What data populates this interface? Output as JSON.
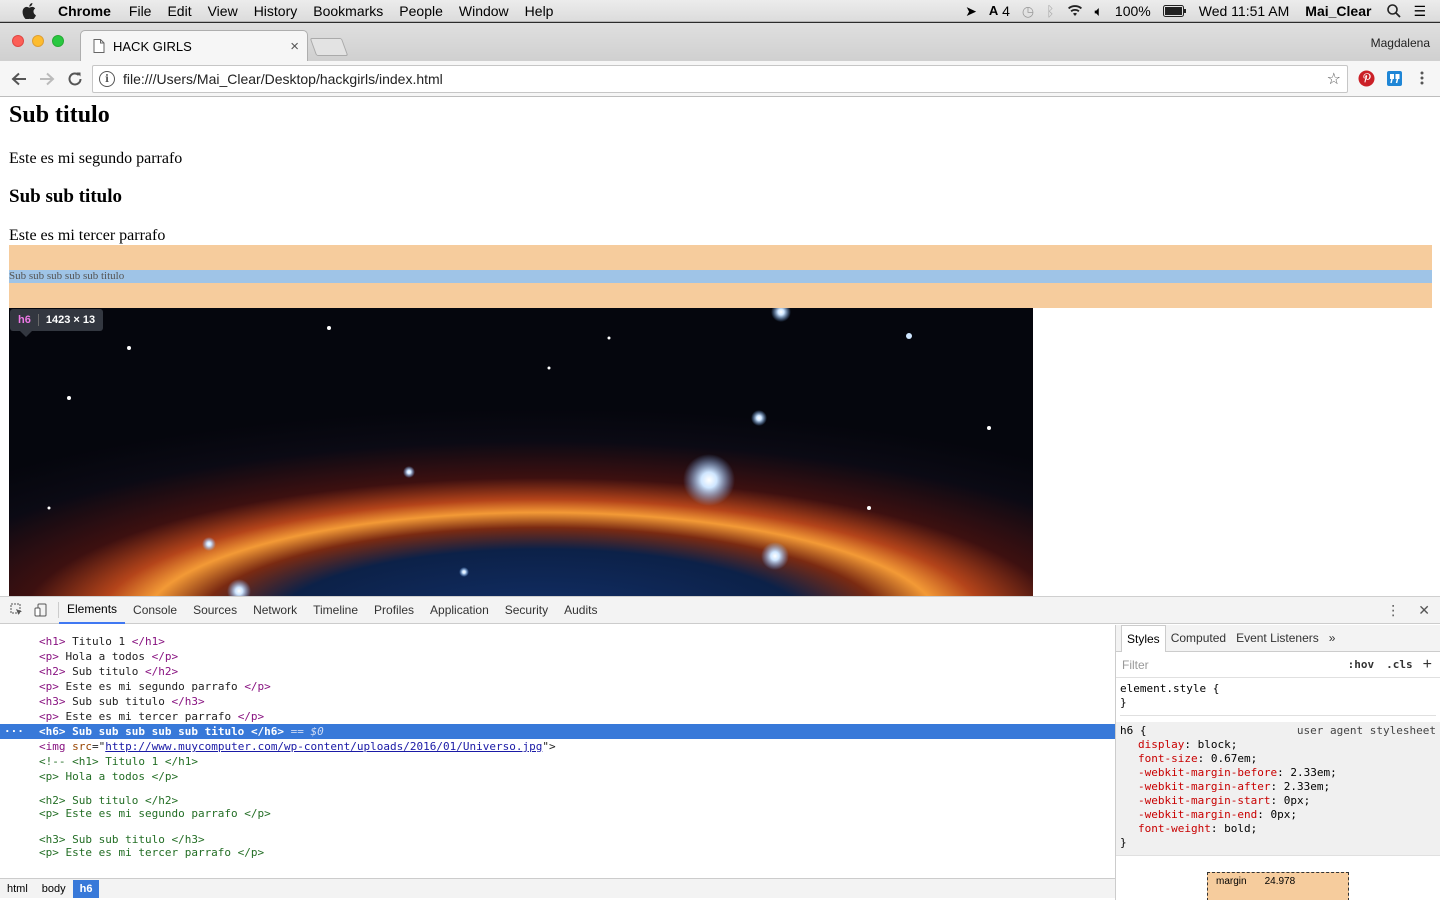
{
  "menubar": {
    "app": "Chrome",
    "items": [
      "File",
      "Edit",
      "View",
      "History",
      "Bookmarks",
      "People",
      "Window",
      "Help"
    ],
    "status": {
      "adobe_count": "4",
      "battery": "100%",
      "clock": "Wed 11:51 AM",
      "user": "Mai_Clear"
    }
  },
  "browser": {
    "tab_title": "HACK GIRLS",
    "profile": "Magdalena",
    "url": "file:///Users/Mai_Clear/Desktop/hackgirls/index.html"
  },
  "page": {
    "h2": "Sub titulo",
    "p_second": "Este es mi segundo parrafo",
    "h3": "Sub sub titulo",
    "p_third": "Este es mi tercer parrafo",
    "h6": "Sub sub sub sub sub titulo",
    "tooltip_tag": "h6",
    "tooltip_size": "1423 × 13"
  },
  "devtools": {
    "tabs": [
      "Elements",
      "Console",
      "Sources",
      "Network",
      "Timeline",
      "Profiles",
      "Application",
      "Security",
      "Audits"
    ],
    "dom_lines": [
      {
        "open": "<h1>",
        "text": " Titulo 1 ",
        "close": "</h1>"
      },
      {
        "open": "<p>",
        "text": " Hola a todos ",
        "close": "</p>"
      },
      {
        "open": "<h2>",
        "text": " Sub titulo ",
        "close": "</h2>"
      },
      {
        "open": "<p>",
        "text": " Este es mi segundo parrafo ",
        "close": "</p>"
      },
      {
        "open": "<h3>",
        "text": " Sub sub titulo ",
        "close": "</h3>"
      },
      {
        "open": "<p>",
        "text": " Este es mi tercer parrafo ",
        "close": "</p>"
      },
      {
        "open": "<h6>",
        "text": " Sub sub sub sub sub titulo ",
        "close": "</h6>",
        "suffix": " == $0"
      },
      {
        "img_open": "<img ",
        "attr": "src",
        "eq": "=\"",
        "url": "http://www.muycomputer.com/wp-content/uploads/2016/01/Universo.jpg",
        "end": "\">"
      }
    ],
    "comment_lines": [
      "<!-- <h1> Titulo 1 </h1>",
      "<p> Hola a todos </p>",
      "<h2> Sub titulo </h2>",
      "<p> Este es mi segundo parrafo </p>",
      "<h3> Sub sub titulo </h3>",
      "<p> Este es mi tercer parrafo </p>"
    ],
    "breadcrumbs": [
      "html",
      "body",
      "h6"
    ],
    "sidebar_tabs": [
      "Styles",
      "Computed",
      "Event Listeners"
    ],
    "filter_placeholder": "Filter",
    "hov": ":hov",
    "cls": ".cls",
    "element_style": "element.style {",
    "rule_selector": "h6 {",
    "rule_source": "user agent stylesheet",
    "rule_props": [
      {
        "name": "display",
        "value": "block;"
      },
      {
        "name": "font-size",
        "value": "0.67em;"
      },
      {
        "name": "-webkit-margin-before",
        "value": "2.33em;"
      },
      {
        "name": "-webkit-margin-after",
        "value": "2.33em;"
      },
      {
        "name": "-webkit-margin-start",
        "value": "0px;"
      },
      {
        "name": "-webkit-margin-end",
        "value": "0px;"
      },
      {
        "name": "font-weight",
        "value": "bold;"
      }
    ],
    "box_label": "margin",
    "box_value": "24.978"
  }
}
